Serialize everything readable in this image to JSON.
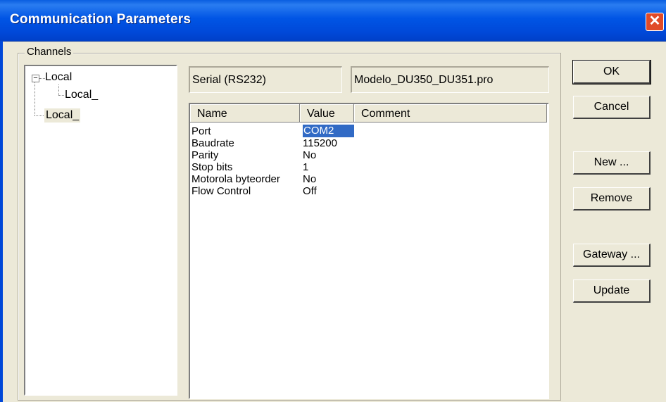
{
  "window": {
    "title": "Communication Parameters",
    "close_glyph": "✕"
  },
  "channels": {
    "label": "Channels",
    "tree": [
      {
        "label": "Local"
      },
      {
        "label": "Local_"
      },
      {
        "label": "Local_"
      }
    ]
  },
  "info": {
    "connection": "Serial (RS232)",
    "file": "Modelo_DU350_DU351.pro"
  },
  "table": {
    "columns": [
      "Name",
      "Value",
      "Comment"
    ],
    "rows": [
      {
        "name": "Port",
        "value": "COM2"
      },
      {
        "name": "Baudrate",
        "value": "115200"
      },
      {
        "name": "Parity",
        "value": "No"
      },
      {
        "name": "Stop bits",
        "value": "1"
      },
      {
        "name": "Motorola byteorder",
        "value": "No"
      },
      {
        "name": "Flow Control",
        "value": "Off"
      }
    ]
  },
  "buttons": {
    "ok": "OK",
    "cancel": "Cancel",
    "new": "New ...",
    "remove": "Remove",
    "gateway": "Gateway ...",
    "update": "Update"
  }
}
